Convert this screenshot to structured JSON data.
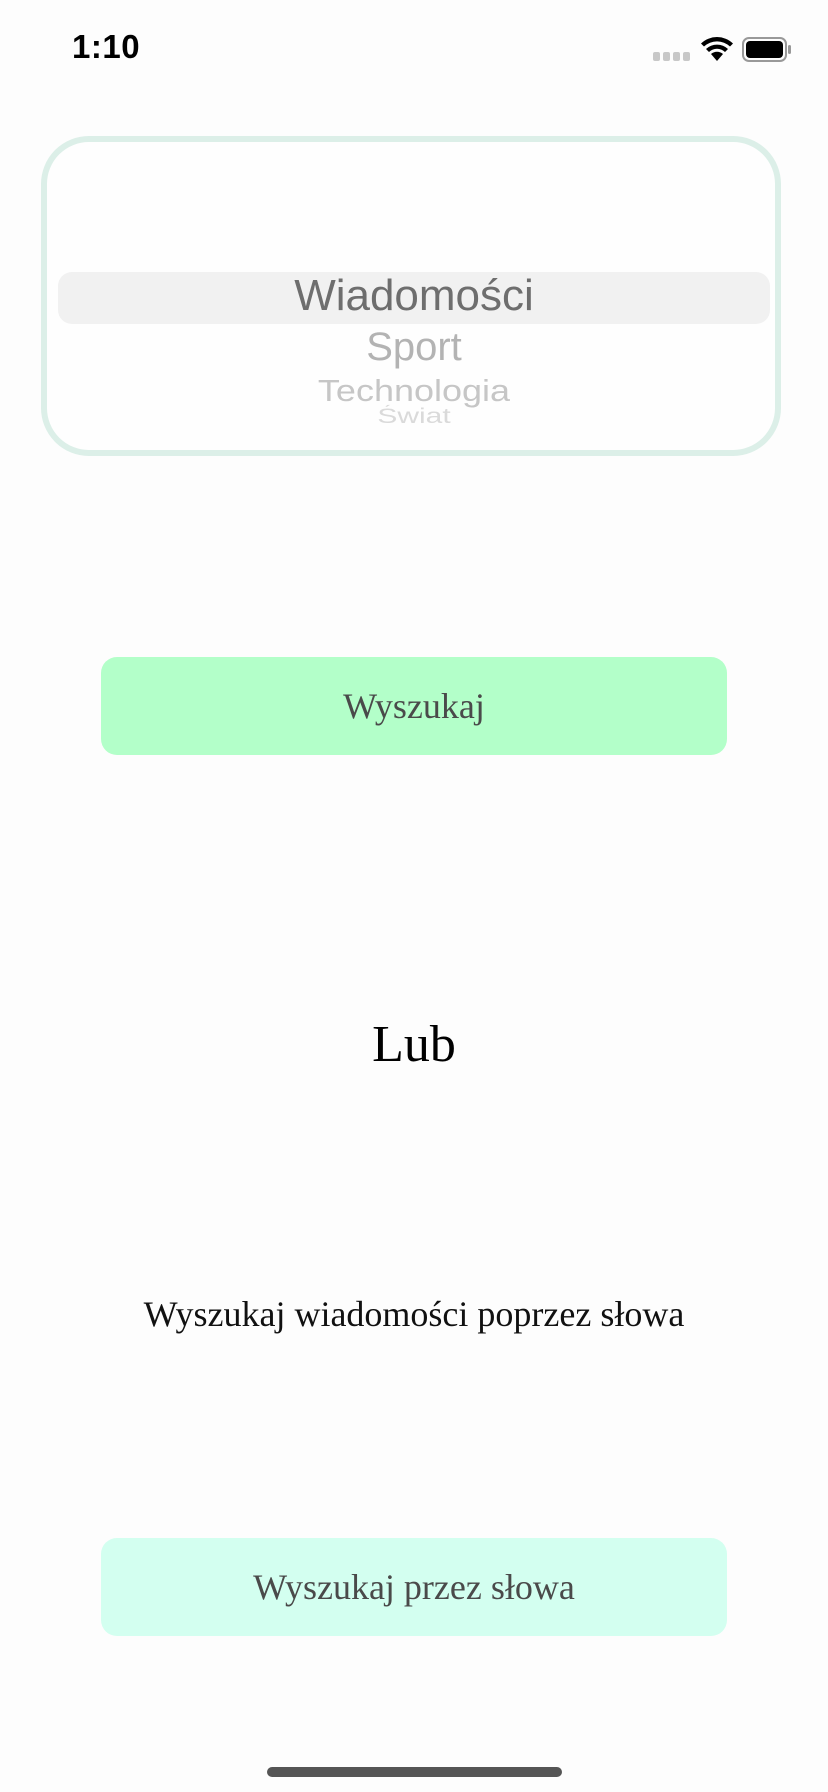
{
  "status_bar": {
    "time": "1:10"
  },
  "picker": {
    "items": [
      "Wiadomości",
      "Sport",
      "Technologia",
      "Świat"
    ],
    "selected": "Wiadomości"
  },
  "search_button": {
    "label": "Wyszukaj"
  },
  "separator": {
    "text": "Lub"
  },
  "keyword_search": {
    "label": "Wyszukaj wiadomości poprzez słowa",
    "button_label": "Wyszukaj przez słowa"
  },
  "colors": {
    "search_button_bg": "#b3ffc9",
    "keyword_button_bg": "#d3fff0",
    "picker_border": "#dcefe8"
  }
}
